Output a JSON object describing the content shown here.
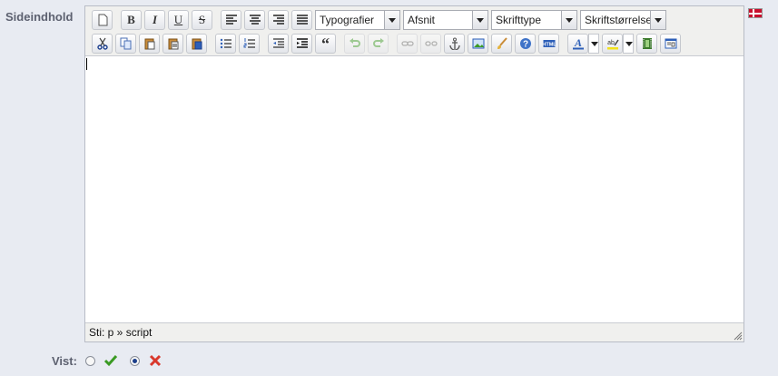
{
  "field": {
    "label": "Sideindhold",
    "language_flag": "denmark-flag"
  },
  "toolbar": {
    "selects": {
      "typografier": "Typografier",
      "afsnit": "Afsnit",
      "skrifttype": "Skrifttype",
      "skriftstorrelse": "Skriftstørrelse"
    },
    "row1_buttons": [
      "new-document",
      "bold",
      "italic",
      "underline",
      "strikethrough",
      "align-left",
      "align-center",
      "align-right",
      "align-justify"
    ],
    "row2_buttons": [
      "cut",
      "copy",
      "paste",
      "paste-text",
      "paste-word",
      "bullet-list",
      "numbered-list",
      "outdent",
      "indent",
      "blockquote",
      "undo",
      "redo",
      "link",
      "unlink",
      "anchor",
      "image",
      "cleanup",
      "help",
      "html-source",
      "text-color",
      "highlight-color",
      "media",
      "template"
    ]
  },
  "editor": {
    "content": "",
    "status_path": "Sti: p » script"
  },
  "visible": {
    "label": "Vist:",
    "options": [
      {
        "name": "yes",
        "icon": "green-check-icon",
        "selected": false
      },
      {
        "name": "no",
        "icon": "red-x-icon",
        "selected": true
      }
    ]
  },
  "colors": {
    "accent_text": "#5d6170",
    "check": "#3a9a23",
    "cross": "#d9382c",
    "flag_red": "#c8102e"
  }
}
